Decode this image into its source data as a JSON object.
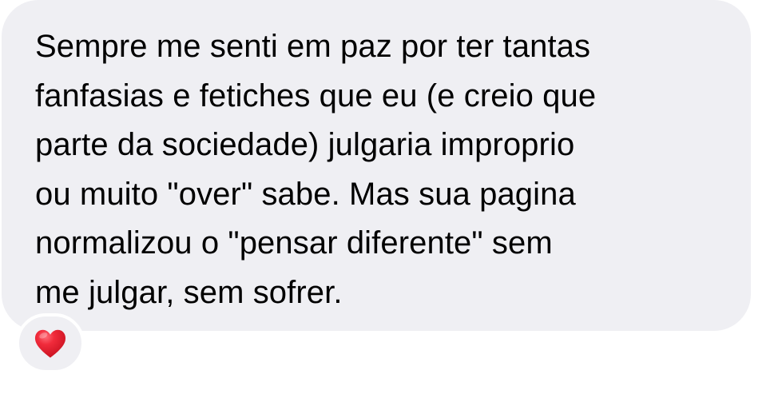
{
  "message": {
    "text": "Sempre me senti em paz por ter tantas\nfanfasias e fetiches que eu (e creio que\nparte da sociedade) julgaria improprio\nou muito \"over\" sabe. Mas sua pagina\nnormalizou o \"pensar diferente\" sem\nme julgar, sem sofrer.",
    "bubble_color": "#efeff3",
    "text_color": "#000000"
  },
  "reaction": {
    "icon": "heart-icon",
    "color": "#e8192c"
  }
}
